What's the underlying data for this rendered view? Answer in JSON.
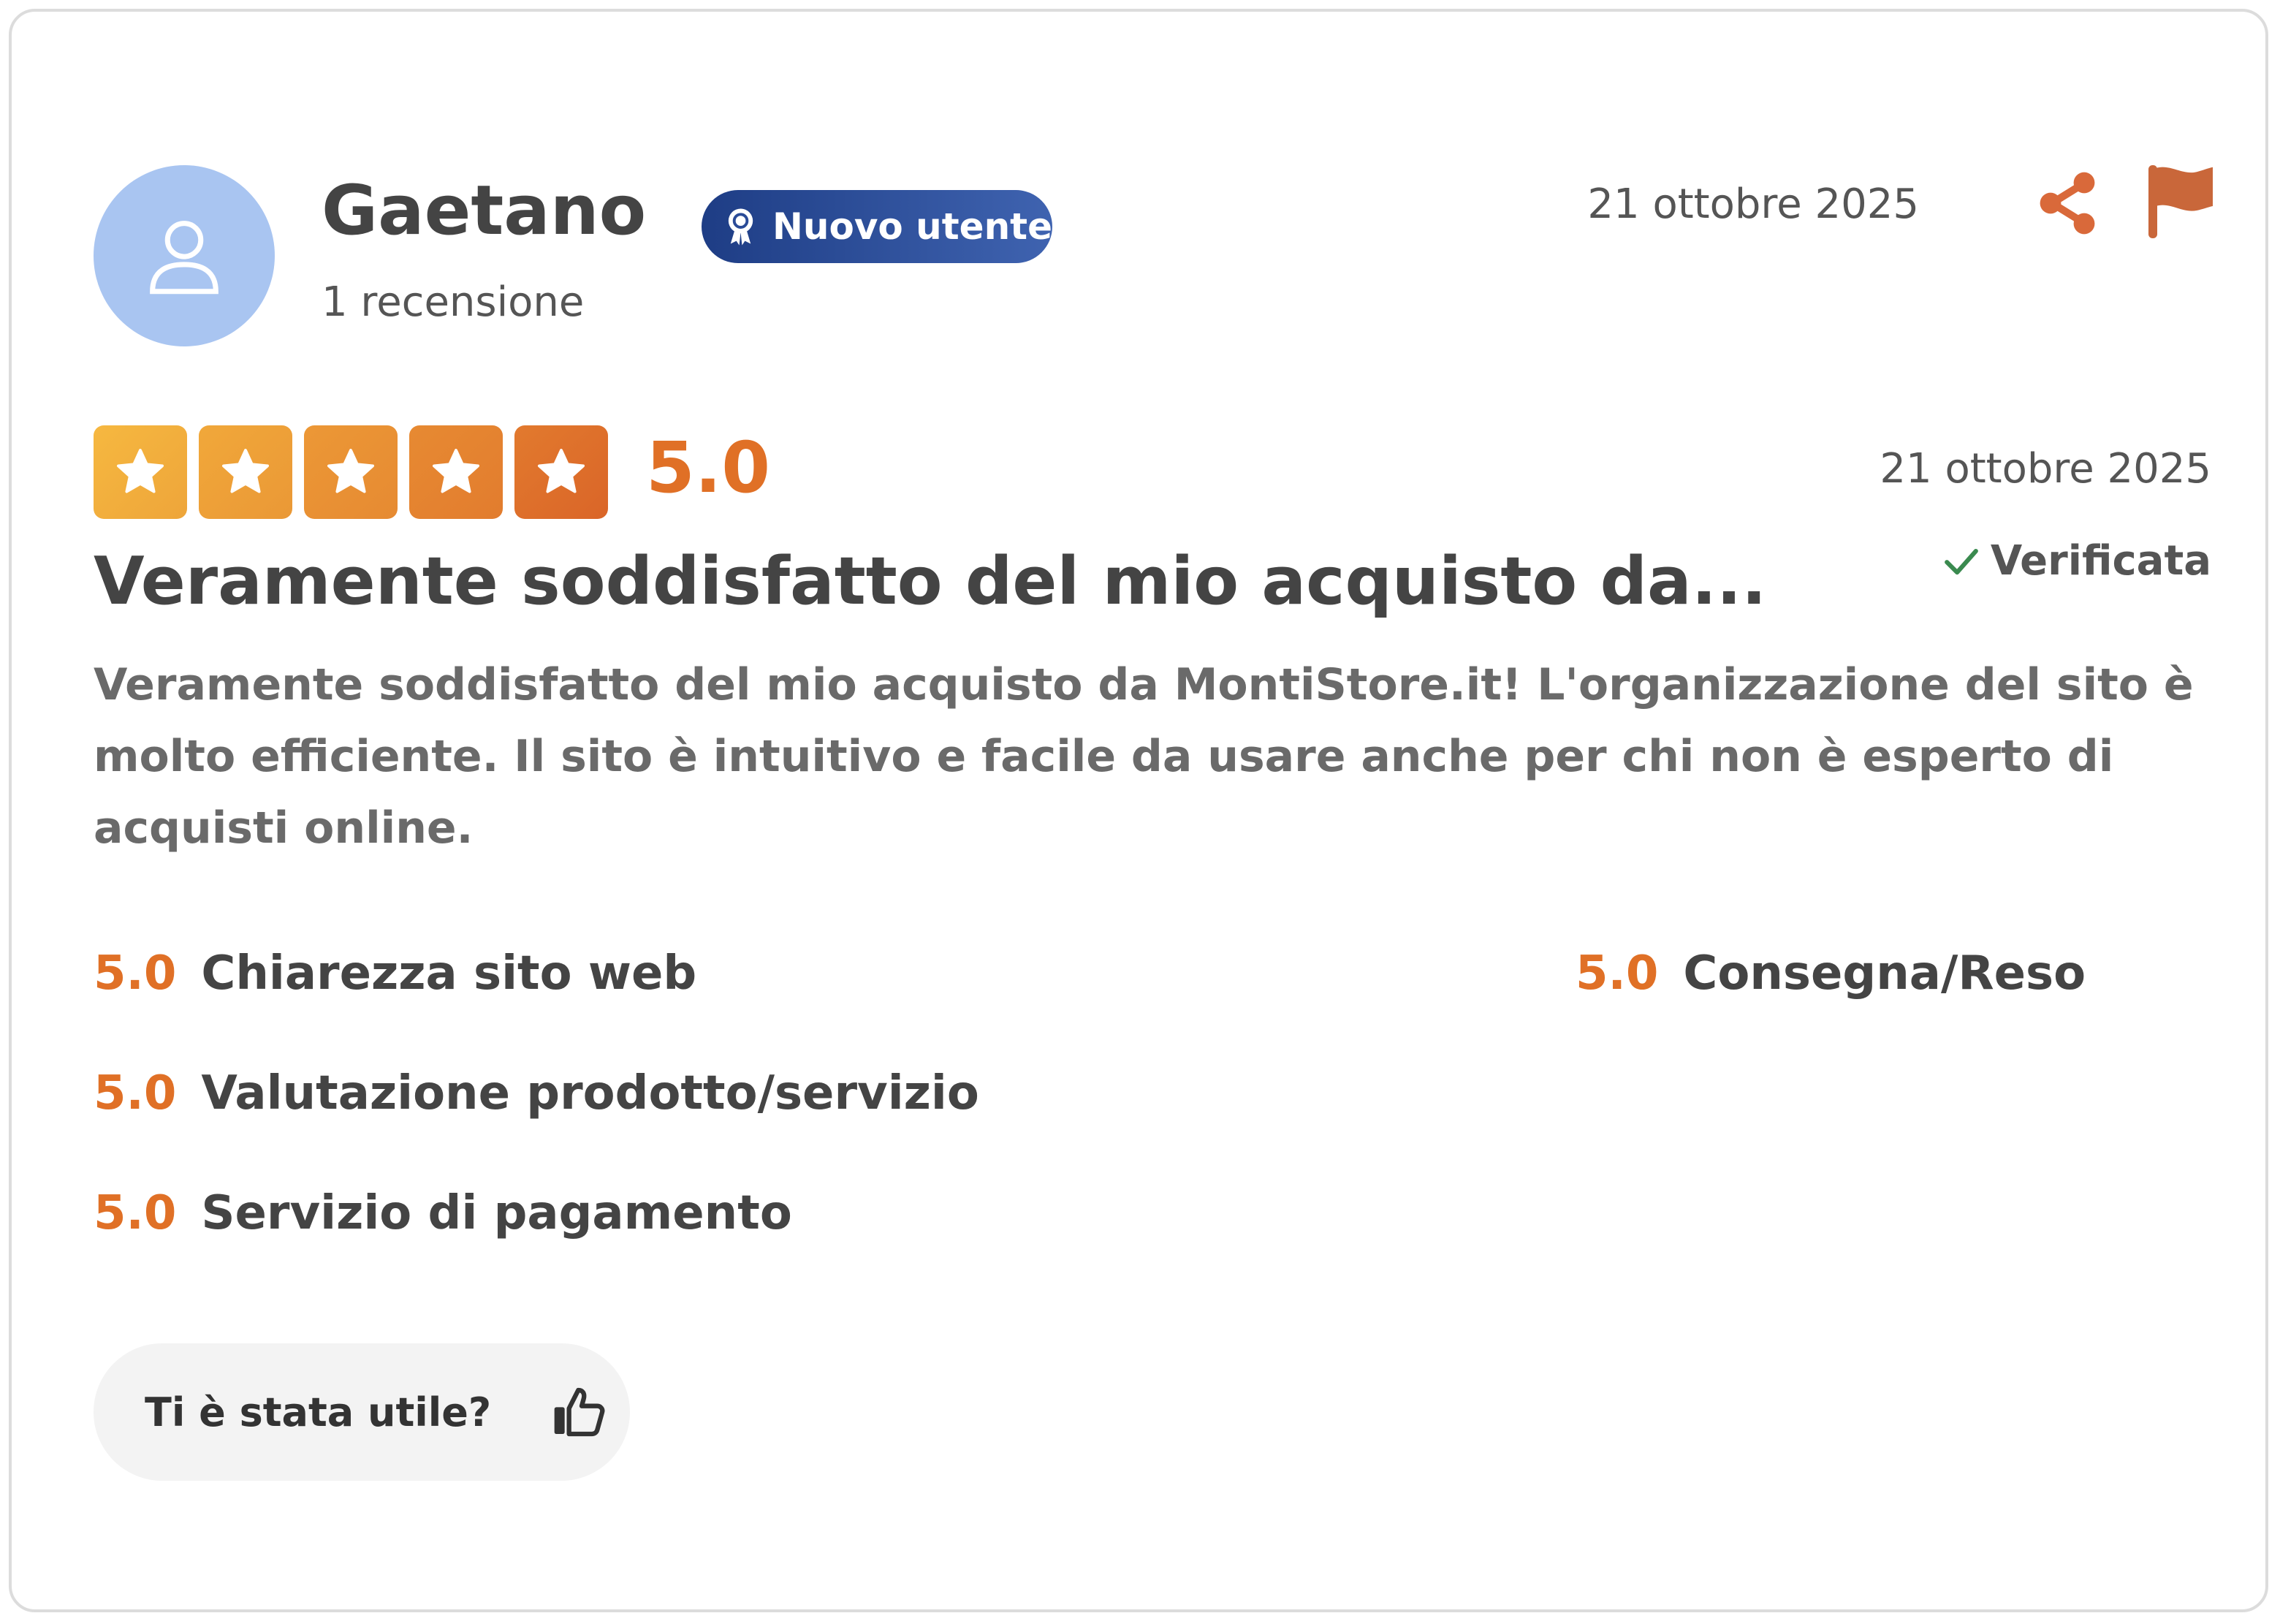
{
  "user": {
    "name": "Gaetano",
    "reviews_count": "1 recensione",
    "badge": "Nuovo utente",
    "avatar_icon": "user-icon"
  },
  "header": {
    "date": "21 ottobre 2025",
    "share_icon": "share-icon",
    "flag_icon": "flag-icon"
  },
  "rating": {
    "value": "5.0",
    "stars_filled": 5,
    "stars_total": 5,
    "date": "21 ottobre 2025",
    "verified_label": "Verificata"
  },
  "review": {
    "title": "Veramente soddisfatto del mio acquisto da...",
    "body": "Veramente soddisfatto del mio acquisto da MontiStore.it! L'organizzazione del sito è molto efficiente. Il sito è intuitivo e facile da usare anche per chi non è esperto di acquisti online."
  },
  "criteria": [
    {
      "value": "5.0",
      "label": "Chiarezza sito web"
    },
    {
      "value": "5.0",
      "label": "Consegna/Reso"
    },
    {
      "value": "5.0",
      "label": "Valutazione prodotto/servizio"
    },
    {
      "value": "5.0",
      "label": "Servizio di pagamento"
    }
  ],
  "helpful": {
    "label": "Ti è stata utile?",
    "icon": "thumbs-up-icon"
  },
  "colors": {
    "accent": "#e07026",
    "badge": "#2a4b97",
    "avatar_bg": "#a9c5f1",
    "verified": "#3a8a4f",
    "star_gradient_start": "#f5b341",
    "star_gradient_end": "#de6a2a"
  }
}
